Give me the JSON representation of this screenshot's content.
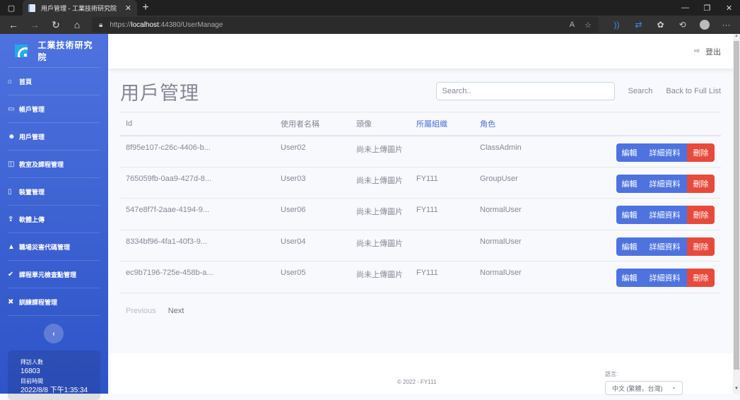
{
  "browser": {
    "tab_title": "用戶管理 - 工業技術研究院",
    "url_scheme": "https://",
    "url_host": "localhost",
    "url_rest": ":44380/UserManage"
  },
  "sidebar": {
    "brand": "工業技術研究院",
    "items": [
      {
        "label": "首頁",
        "icon": "home-icon",
        "glyph": "⌂"
      },
      {
        "label": "帳戶管理",
        "icon": "id-card-icon",
        "glyph": "▭"
      },
      {
        "label": "用戶管理",
        "icon": "users-icon",
        "glyph": "☻"
      },
      {
        "label": "教室及課程管理",
        "icon": "chalkboard-icon",
        "glyph": "◫"
      },
      {
        "label": "裝置管理",
        "icon": "mobile-icon",
        "glyph": "▯"
      },
      {
        "label": "軟體上傳",
        "icon": "upload-icon",
        "glyph": "⇪"
      },
      {
        "label": "職場災害代碼管理",
        "icon": "warning-icon",
        "glyph": "▲"
      },
      {
        "label": "課程單元檢查點管理",
        "icon": "check-circle-icon",
        "glyph": "✔"
      },
      {
        "label": "訓練課程管理",
        "icon": "tools-icon",
        "glyph": "✖"
      }
    ],
    "toggle_glyph": "‹",
    "stats": {
      "visitors_label": "拜訪人數",
      "visitors_value": "16803",
      "time_label": "目前時間",
      "time_value": "2022/8/8 下午1:35:34"
    }
  },
  "topbar": {
    "logout_label": "登出"
  },
  "main": {
    "title": "用戶管理",
    "search_placeholder": "Search..",
    "search_label": "Search",
    "back_label": "Back to Full List",
    "columns": [
      "Id",
      "使用者名稱",
      "頭像",
      "所屬組織",
      "角色"
    ],
    "rows": [
      {
        "id": "8f95e107-c26c-4406-b...",
        "name": "User02",
        "avatar": "尚未上傳圖片",
        "org": "",
        "role": "ClassAdmin"
      },
      {
        "id": "765059fb-0aa9-427d-8...",
        "name": "User03",
        "avatar": "尚未上傳圖片",
        "org": "FY111",
        "role": "GroupUser"
      },
      {
        "id": "547e8f7f-2aae-4194-9...",
        "name": "User06",
        "avatar": "尚未上傳圖片",
        "org": "FY111",
        "role": "NormalUser"
      },
      {
        "id": "8334bf96-4fa1-40f3-9...",
        "name": "User04",
        "avatar": "尚未上傳圖片",
        "org": "",
        "role": "NormalUser"
      },
      {
        "id": "ec9b7196-725e-458b-a...",
        "name": "User05",
        "avatar": "尚未上傳圖片",
        "org": "FY111",
        "role": "NormalUser"
      }
    ],
    "actions": {
      "edit": "編輯",
      "details": "詳細資料",
      "delete": "刪除"
    },
    "pager": {
      "previous": "Previous",
      "next": "Next"
    }
  },
  "footer": {
    "copyright": "© 2022 - FY111",
    "language_label": "語言:",
    "language_value": "中文 (繁體，台灣)"
  },
  "colors": {
    "primary": "#4e73df",
    "danger": "#e74a3b",
    "sidebar_top": "#4e73df"
  }
}
